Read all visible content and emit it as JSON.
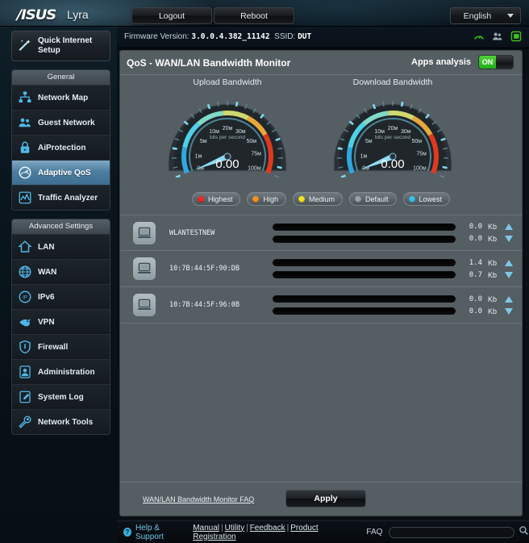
{
  "header": {
    "brand": "/ISUS",
    "model": "Lyra",
    "logout_label": "Logout",
    "reboot_label": "Reboot",
    "language": "English",
    "firmware_prefix": "Firmware Version:",
    "firmware_version": "3.0.0.4.382_11142",
    "ssid_prefix": "SSID:",
    "ssid": "DUT",
    "status_icons": [
      {
        "name": "qos-status-icon",
        "color": "#3fc21f"
      },
      {
        "name": "clients-status-icon",
        "color": "#9aa6ac"
      },
      {
        "name": "usb-status-icon",
        "color": "#3fc21f"
      }
    ]
  },
  "sidebar": {
    "quick_internet_setup": "Quick Internet Setup",
    "groups": [
      {
        "title": "General",
        "items": [
          {
            "label": "Network Map",
            "icon": "network-map-icon",
            "active": false
          },
          {
            "label": "Guest Network",
            "icon": "guest-network-icon",
            "active": false
          },
          {
            "label": "AiProtection",
            "icon": "aiprotection-icon",
            "active": false
          },
          {
            "label": "Adaptive QoS",
            "icon": "adaptive-qos-icon",
            "active": true
          },
          {
            "label": "Traffic Analyzer",
            "icon": "traffic-analyzer-icon",
            "active": false
          }
        ]
      },
      {
        "title": "Advanced Settings",
        "items": [
          {
            "label": "LAN",
            "icon": "lan-icon",
            "active": false
          },
          {
            "label": "WAN",
            "icon": "wan-icon",
            "active": false
          },
          {
            "label": "IPv6",
            "icon": "ipv6-icon",
            "active": false
          },
          {
            "label": "VPN",
            "icon": "vpn-icon",
            "active": false
          },
          {
            "label": "Firewall",
            "icon": "firewall-icon",
            "active": false
          },
          {
            "label": "Administration",
            "icon": "administration-icon",
            "active": false
          },
          {
            "label": "System Log",
            "icon": "system-log-icon",
            "active": false
          },
          {
            "label": "Network Tools",
            "icon": "network-tools-icon",
            "active": false
          }
        ]
      }
    ]
  },
  "panel": {
    "title": "QoS - WAN/LAN Bandwidth Monitor",
    "apps_analysis_label": "Apps analysis",
    "apps_analysis_state": "ON",
    "gauges": [
      {
        "name": "upload-gauge",
        "caption": "Upload Bandwidth",
        "value": "0.00",
        "unit_label": "bits per second",
        "ticks": [
          "0м",
          "1м",
          "5м",
          "10м",
          "20м",
          "30м",
          "50м",
          "75м",
          "100м"
        ]
      },
      {
        "name": "download-gauge",
        "caption": "Download Bandwidth",
        "value": "0.00",
        "unit_label": "bits per second",
        "ticks": [
          "0м",
          "1м",
          "5м",
          "10м",
          "20м",
          "30м",
          "50м",
          "75м",
          "100м"
        ]
      }
    ],
    "legend": [
      {
        "label": "Highest",
        "color": "#ee2a24"
      },
      {
        "label": "High",
        "color": "#f59420"
      },
      {
        "label": "Medium",
        "color": "#f2e320"
      },
      {
        "label": "Default",
        "color": "#9aa3a8"
      },
      {
        "label": "Lowest",
        "color": "#39bfe8"
      }
    ],
    "devices": [
      {
        "name": "WLANTESTNEW",
        "icon": "computer-icon",
        "upload_value": "0.0",
        "upload_unit": "Kb",
        "download_value": "0.0",
        "download_unit": "Kb"
      },
      {
        "name": "10:7B:44:5F:90:DB",
        "icon": "computer-icon",
        "upload_value": "1.4",
        "upload_unit": "Kb",
        "download_value": "0.7",
        "download_unit": "Kb"
      },
      {
        "name": "10:7B:44:5F:96:0B",
        "icon": "computer-icon",
        "upload_value": "0.0",
        "upload_unit": "Kb",
        "download_value": "0.0",
        "download_unit": "Kb"
      }
    ],
    "footer_faq_link": "WAN/LAN Bandwidth Monitor FAQ",
    "apply_label": "Apply"
  },
  "bottom": {
    "help_support": "Help & Support",
    "manual": "Manual",
    "utility": "Utility",
    "feedback": "Feedback",
    "product_registration": "Product Registration",
    "faq_label": "FAQ",
    "faq_placeholder": "",
    "faq_value": ""
  },
  "chart_data": {
    "type": "bar",
    "title": "QoS - WAN/LAN Bandwidth Monitor",
    "categories": [
      "WLANTESTNEW",
      "10:7B:44:5F:90:DB",
      "10:7B:44:5F:96:0B"
    ],
    "series": [
      {
        "name": "Upload (Kb)",
        "values": [
          0.0,
          1.4,
          0.0
        ]
      },
      {
        "name": "Download (Kb)",
        "values": [
          0.0,
          0.7,
          0.0
        ]
      }
    ],
    "gauges": [
      {
        "name": "Upload Bandwidth",
        "value": 0.0,
        "unit": "bits per second",
        "scale": [
          0,
          1,
          5,
          10,
          20,
          30,
          50,
          75,
          100
        ],
        "scale_suffix": "M"
      },
      {
        "name": "Download Bandwidth",
        "value": 0.0,
        "unit": "bits per second",
        "scale": [
          0,
          1,
          5,
          10,
          20,
          30,
          50,
          75,
          100
        ],
        "scale_suffix": "M"
      }
    ],
    "xlabel": "",
    "ylabel": "Kb",
    "ylim": [
      0,
      2
    ]
  }
}
